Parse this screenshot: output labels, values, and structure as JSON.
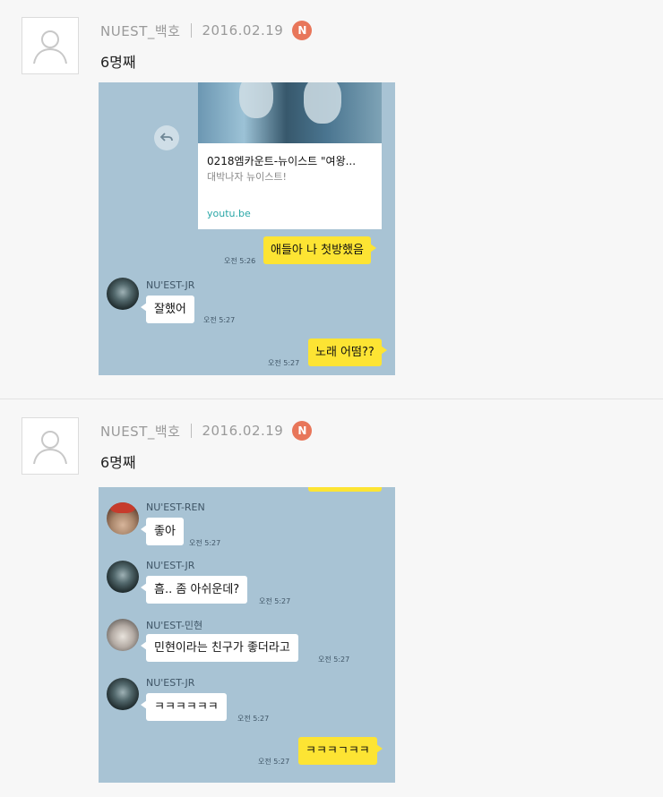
{
  "posts": [
    {
      "author": "NUEST_백호",
      "date": "2016.02.19",
      "badge": "N",
      "text": "6명째",
      "chat": {
        "link_preview": {
          "title": "0218엠카운트-뉴이스트 \"여왕...",
          "description": "대박나자 뉴이스트!",
          "url": "youtu.be"
        },
        "messages": [
          {
            "from": "me",
            "text": "애들아 나 첫방했음",
            "time": "오전 5:26"
          },
          {
            "from": "NU'EST-JR",
            "text": "잘했어",
            "time": "오전 5:27"
          },
          {
            "from": "me",
            "text": "노래 어떰??",
            "time": "오전 5:27"
          }
        ]
      }
    },
    {
      "author": "NUEST_백호",
      "date": "2016.02.19",
      "badge": "N",
      "text": "6명째",
      "chat": {
        "messages": [
          {
            "from": "NU'EST-REN",
            "text": "좋아",
            "time": "오전 5:27"
          },
          {
            "from": "NU'EST-JR",
            "text": "흠.. 좀 아쉬운데?",
            "time": "오전 5:27"
          },
          {
            "from": "NU'EST-민현",
            "text": "민현이라는 친구가 좋더라고",
            "time": "오전 5:27"
          },
          {
            "from": "NU'EST-JR",
            "text": "ㅋㅋㅋㅋㅋㅋ",
            "time": "오전 5:27"
          },
          {
            "from": "me",
            "text": "ㅋㅋㅋㄱㅋㅋ",
            "time": "오전 5:27"
          }
        ]
      }
    }
  ],
  "colors": {
    "chat_bg": "#a8c3d4",
    "my_bubble": "#fde433",
    "other_bubble": "#ffffff",
    "badge": "#e8765a",
    "link_url": "#2aa7a7"
  },
  "icons": {
    "default_avatar": "person-silhouette-icon",
    "share": "share-arrow-icon",
    "badge": "new-badge-icon"
  }
}
